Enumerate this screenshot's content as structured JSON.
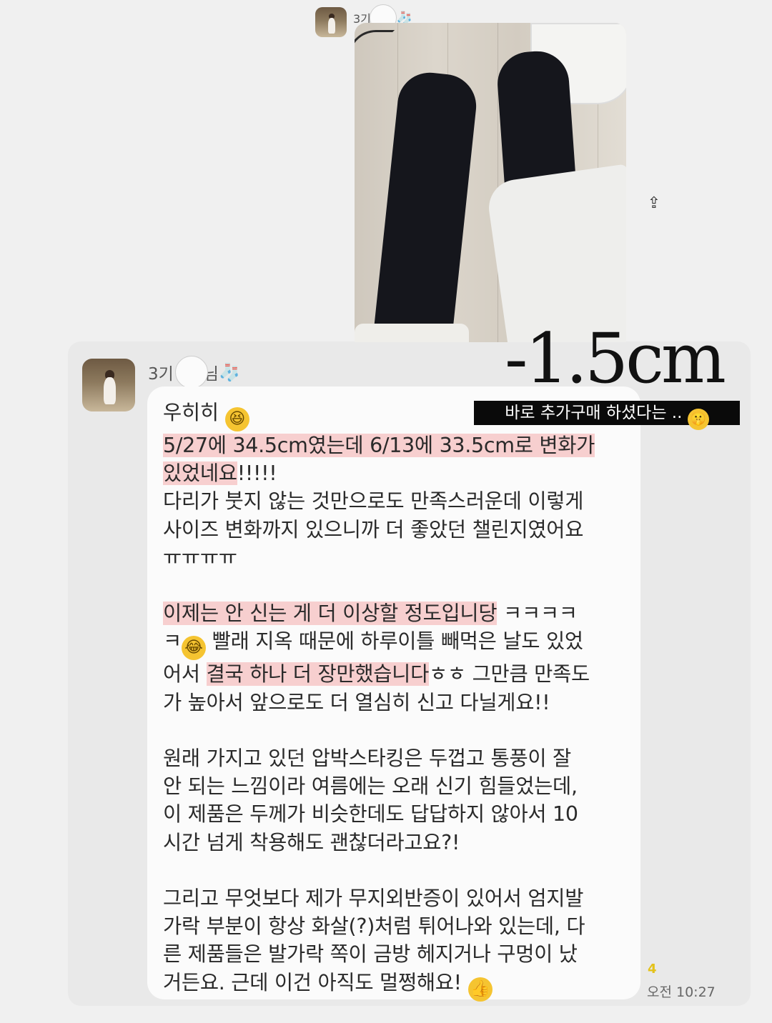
{
  "top_message": {
    "sender_name": "3기",
    "sender_suffix": "",
    "heart_icon": "white-heart-icon",
    "sock_icon": "sock-icon",
    "share_icon": "share-icon"
  },
  "main_message": {
    "sender_name": "3기",
    "sender_suffix": "님",
    "heart_icon": "white-heart-icon",
    "sock_icon": "sock-icon",
    "paragraphs": [
      {
        "lines": [
          {
            "parts": [
              {
                "text": "우히히 ",
                "hl": false
              }
            ],
            "emoji": "😆"
          },
          {
            "parts": [
              {
                "text": "5/27에 34.5cm였는데 6/13에 33.5cm로 변화가",
                "hl": true
              }
            ]
          },
          {
            "parts": [
              {
                "text": "있었네요",
                "hl": true
              },
              {
                "text": "!!!!!",
                "hl": false
              }
            ]
          },
          {
            "parts": [
              {
                "text": "다리가 붓지 않는 것만으로도 만족스러운데 이렇게",
                "hl": false
              }
            ]
          },
          {
            "parts": [
              {
                "text": "사이즈 변화까지 있으니까 더 좋았던 챌린지였어요",
                "hl": false
              }
            ]
          },
          {
            "parts": [
              {
                "text": "ㅠㅠㅠㅠ",
                "hl": false
              }
            ]
          }
        ]
      },
      {
        "lines": [
          {
            "parts": [
              {
                "text": "이제는 안 신는 게 더 이상할 정도입니당",
                "hl": true
              },
              {
                "text": " ㅋㅋㅋㅋ",
                "hl": false
              }
            ]
          },
          {
            "parts": [
              {
                "text": "ㅋ",
                "hl": false
              }
            ],
            "emoji": "😂",
            "after": " 빨래 지옥 때문에 하루이틀 빼먹은 날도 있었"
          },
          {
            "parts": [
              {
                "text": "어서 ",
                "hl": false
              },
              {
                "text": "결국 하나 더 장만했습니다",
                "hl": true
              },
              {
                "text": "ㅎㅎ 그만큼 만족도",
                "hl": false
              }
            ]
          },
          {
            "parts": [
              {
                "text": "가 높아서 앞으로도 더 열심히 신고 다닐게요!!",
                "hl": false
              }
            ]
          }
        ]
      },
      {
        "lines": [
          {
            "parts": [
              {
                "text": "원래 가지고 있던 압박스타킹은 두껍고 통풍이 잘",
                "hl": false
              }
            ]
          },
          {
            "parts": [
              {
                "text": "안 되는 느낌이라 여름에는 오래 신기 힘들었는데,",
                "hl": false
              }
            ]
          },
          {
            "parts": [
              {
                "text": "이 제품은 두께가 비슷한데도 답답하지 않아서 10",
                "hl": false
              }
            ]
          },
          {
            "parts": [
              {
                "text": "시간 넘게 착용해도 괜찮더라고요?!",
                "hl": false
              }
            ]
          }
        ]
      },
      {
        "lines": [
          {
            "parts": [
              {
                "text": "그리고 무엇보다 제가 무지외반증이 있어서 엄지발",
                "hl": false
              }
            ]
          },
          {
            "parts": [
              {
                "text": "가락 부분이 항상 화살(?)처럼 튀어나와 있는데, 다",
                "hl": false
              }
            ]
          },
          {
            "parts": [
              {
                "text": "른 제품들은 발가락 쪽이 금방 헤지거나 구멍이 났",
                "hl": false
              }
            ]
          },
          {
            "parts": [
              {
                "text": "거든요. 근데 이건 아직도 멀쩡해요! ",
                "hl": false
              }
            ],
            "emoji": "👍"
          }
        ]
      }
    ],
    "read_count": "4",
    "time": "오전 10:27"
  },
  "overlay": {
    "measurement": "-1.5cm",
    "caption": "바로 추가구매 하셨다는 ..",
    "caption_emoji": "🤫"
  }
}
